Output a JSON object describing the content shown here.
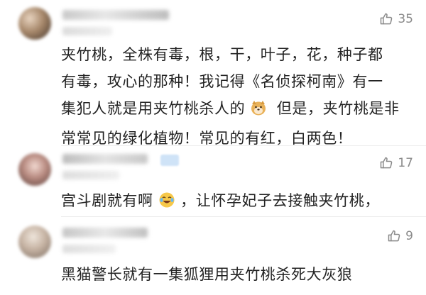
{
  "comments": [
    {
      "likes": "35",
      "text_lines": [
        "夹竹桃，全株有毒，根，干，叶子，花，种子都",
        "有毒，攻心的那种！我记得《名侦探柯南》有一",
        "集犯人就是用夹竹桃杀人的",
        "但是，夹竹桃是非",
        "常常见的绿化植物！常见的有红，白两色！"
      ]
    },
    {
      "likes": "17",
      "text_lines": [
        "宫斗剧就有啊",
        "，让怀孕妃子去接触夹竹桃，"
      ]
    },
    {
      "likes": "9",
      "text_lines": [
        "黑猫警长就有一集狐狸用夹竹桃杀死大灰狼"
      ]
    }
  ],
  "icons": {
    "like": "thumbs-up-icon",
    "dog_emoji": "doge-emoji-icon",
    "laugh_emoji": "laughing-crying-emoji-icon"
  },
  "colors": {
    "meta_gray": "#8a8a8a",
    "divider": "#ececec"
  }
}
